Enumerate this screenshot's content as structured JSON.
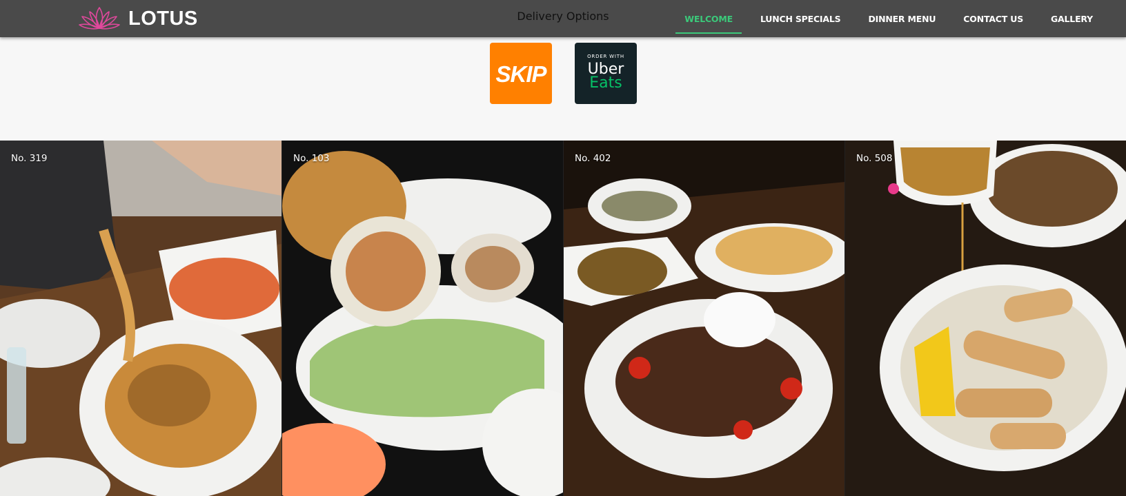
{
  "brand": {
    "name": "LOTUS",
    "logo_icon": "lotus-icon",
    "accent": "#e0489c"
  },
  "header": {
    "delivery_title": "Delivery Options"
  },
  "nav": {
    "active_color": "#3bc97a",
    "items": [
      {
        "label": "WELCOME",
        "active": true
      },
      {
        "label": "LUNCH SPECIALS"
      },
      {
        "label": "DINNER MENU"
      },
      {
        "label": "CONTACT US"
      },
      {
        "label": "GALLERY"
      }
    ]
  },
  "delivery": {
    "skip": {
      "label": "SKIP",
      "color": "#ff8000"
    },
    "ubereats": {
      "top": "ORDER WITH",
      "middle": "Uber",
      "bottom": "Eats",
      "color": "#142328",
      "accent": "#06c167"
    }
  },
  "gallery": {
    "tiles": [
      {
        "label": "No. 319"
      },
      {
        "label": "No. 103"
      },
      {
        "label": "No. 402"
      },
      {
        "label": "No. 508"
      }
    ]
  }
}
